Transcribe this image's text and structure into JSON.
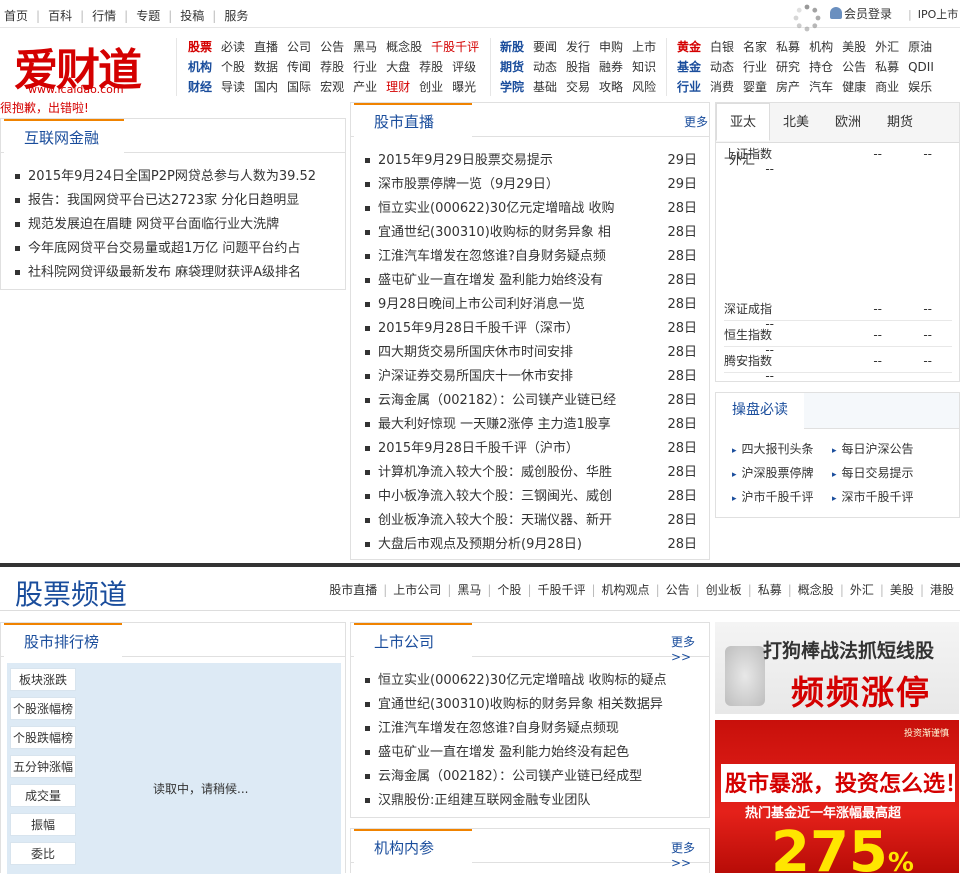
{
  "topnav": [
    "首页",
    "百科",
    "行情",
    "专题",
    "投稿",
    "服务"
  ],
  "user": {
    "login": "会员登录",
    "ipo": "IPO上市"
  },
  "logo": {
    "name": "爱财道",
    "url": "www.icaidao.com"
  },
  "nav_groups": [
    {
      "rows": [
        [
          "股票",
          "必读",
          "直播",
          "公司",
          "公告",
          "黑马",
          "概念股",
          "千股千评"
        ],
        [
          "机构",
          "个股",
          "数据",
          "传闻",
          "荐股",
          "行业",
          "大盘",
          "荐股",
          "评级"
        ],
        [
          "财经",
          "导读",
          "国内",
          "国际",
          "宏观",
          "产业",
          "理财",
          "创业",
          "曝光"
        ]
      ]
    },
    {
      "rows": [
        [
          "新股",
          "要闻",
          "发行",
          "申购",
          "上市"
        ],
        [
          "期货",
          "动态",
          "股指",
          "融券",
          "知识"
        ],
        [
          "学院",
          "基础",
          "交易",
          "攻略",
          "风险"
        ]
      ]
    },
    {
      "rows": [
        [
          "黄金",
          "白银",
          "名家",
          "私募",
          "机构",
          "美股",
          "外汇",
          "原油"
        ],
        [
          "基金",
          "动态",
          "行业",
          "研究",
          "持仓",
          "公告",
          "私募",
          "QDII"
        ],
        [
          "行业",
          "消费",
          "婴童",
          "房产",
          "汽车",
          "健康",
          "商业",
          "娱乐"
        ]
      ]
    }
  ],
  "sorry": "很抱歉，出错啦!",
  "fintech": {
    "title": "互联网金融",
    "items": [
      "2015年9月24日全国P2P网贷总参与人数为39.52",
      "报告：我国网贷平台已达2723家 分化日趋明显",
      "规范发展迫在眉睫 网贷平台面临行业大洗牌",
      "今年底网贷平台交易量或超1万亿 问题平台约占",
      "社科院网贷评级最新发布 麻袋理财获评A级排名"
    ]
  },
  "live": {
    "title": "股市直播",
    "more": "更多",
    "items": [
      {
        "t": "2015年9月29日股票交易提示",
        "d": "29日"
      },
      {
        "t": "深市股票停牌一览（9月29日）",
        "d": "29日"
      },
      {
        "t": "恒立实业(000622)30亿元定增暗战 收购",
        "d": "28日"
      },
      {
        "t": "宜通世纪(300310)收购标的财务异象 相",
        "d": "28日"
      },
      {
        "t": "江淮汽车增发在忽悠谁?自身财务疑点频",
        "d": "28日"
      },
      {
        "t": "盛屯矿业一直在增发 盈利能力始终没有",
        "d": "28日"
      },
      {
        "t": "9月28日晚间上市公司利好消息一览",
        "d": "28日"
      },
      {
        "t": "2015年9月28日千股千评（深市）",
        "d": "28日"
      },
      {
        "t": "四大期货交易所国庆休市时间安排",
        "d": "28日"
      },
      {
        "t": "沪深证券交易所国庆十一休市安排",
        "d": "28日"
      },
      {
        "t": "云海金属（002182）：公司镁产业链已经",
        "d": "28日"
      },
      {
        "t": "最大利好惊现 一天赚2涨停 主力造1股享",
        "d": "28日"
      },
      {
        "t": "2015年9月28日千股千评（沪市）",
        "d": "28日"
      },
      {
        "t": "计算机净流入较大个股：威创股份、华胜",
        "d": "28日"
      },
      {
        "t": "中小板净流入较大个股：三钢闽光、威创",
        "d": "28日"
      },
      {
        "t": "创业板净流入较大个股：天瑞仪器、新开",
        "d": "28日"
      },
      {
        "t": "大盘后市观点及预期分析(9月28日)",
        "d": "28日"
      }
    ]
  },
  "market": {
    "tabs": [
      "亚太",
      "北美",
      "欧洲",
      "期货",
      "外汇"
    ],
    "rows": [
      {
        "name": "上证指数",
        "v": [
          "--",
          "--",
          "--"
        ]
      },
      {
        "name": "深证成指",
        "v": [
          "--",
          "--",
          "--"
        ]
      },
      {
        "name": "恒生指数",
        "v": [
          "--",
          "--",
          "--"
        ]
      },
      {
        "name": "腾安指数",
        "v": [
          "--",
          "--",
          "--"
        ]
      }
    ]
  },
  "guide": {
    "title": "操盘必读",
    "items": [
      "四大报刊头条",
      "每日沪深公告",
      "沪深股票停牌",
      "每日交易提示",
      "沪市千股千评",
      "深市千股千评"
    ]
  },
  "channel": {
    "title": "股票频道",
    "links": [
      "股市直播",
      "上市公司",
      "黑马",
      "个股",
      "千股千评",
      "机构观点",
      "公告",
      "创业板",
      "私募",
      "概念股",
      "外汇",
      "美股",
      "港股"
    ]
  },
  "ranking": {
    "title": "股市排行榜",
    "buttons": [
      "板块涨跌",
      "个股涨幅榜",
      "个股跌幅榜",
      "五分钟涨幅",
      "成交量",
      "振幅",
      "委比"
    ],
    "loading": "读取中，请稍候..."
  },
  "companies": {
    "title": "上市公司",
    "more": "更多>>",
    "items": [
      "恒立实业(000622)30亿元定增暗战 收购标的疑点",
      "宜通世纪(300310)收购标的财务异象 相关数据异",
      "江淮汽车增发在忽悠谁?自身财务疑点频现",
      "盛屯矿业一直在增发 盈利能力始终没有起色",
      "云海金属（002182）：公司镁产业链已经成型",
      "汉鼎股份:正组建互联网金融专业团队"
    ]
  },
  "inst": {
    "title": "机构内参",
    "more": "更多>>"
  },
  "ads": {
    "ad1": {
      "line1": "打狗棒战法抓短线股",
      "line2": "频频涨停"
    },
    "ad2": {
      "tag": "投资渐谨慎",
      "line1": "股市暴涨，投资怎么选！",
      "line2": "热门基金近一年涨幅最高超",
      "num": "275",
      "unit": "%"
    }
  },
  "colors": {
    "brand_red": "#d40000",
    "link_blue": "#1a4d9c",
    "accent_orange": "#f08300"
  }
}
